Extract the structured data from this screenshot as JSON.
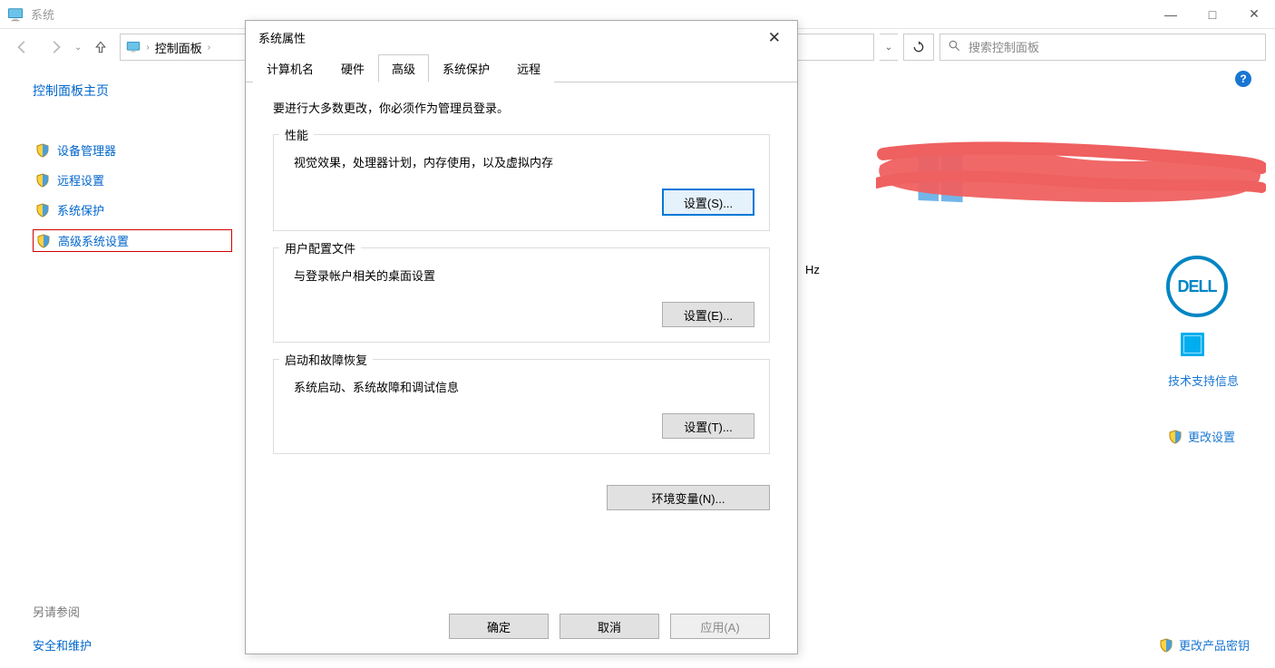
{
  "window": {
    "title": "系统",
    "controls": {
      "minimize": "—",
      "maximize": "□",
      "close": "✕"
    }
  },
  "breadcrumb": {
    "root": "控制面板",
    "dropdown": "⌄",
    "refresh": "⟳"
  },
  "search": {
    "placeholder": "搜索控制面板",
    "icon": "⌕"
  },
  "sidebar": {
    "home": "控制面板主页",
    "items": [
      "设备管理器",
      "远程设置",
      "系统保护",
      "高级系统设置"
    ],
    "see_also_label": "另请参阅",
    "see_also_link": "安全和维护"
  },
  "content": {
    "help": "?",
    "hz_suffix": "Hz",
    "dell": "DELL",
    "tech_support": "技术支持信息",
    "change_settings": "更改设置",
    "change_product_key": "更改产品密钥"
  },
  "dialog": {
    "title": "系统属性",
    "close": "✕",
    "tabs": [
      "计算机名",
      "硬件",
      "高级",
      "系统保护",
      "远程"
    ],
    "active_tab": "高级",
    "admin_note": "要进行大多数更改，你必须作为管理员登录。",
    "performance": {
      "title": "性能",
      "desc": "视觉效果，处理器计划，内存使用，以及虚拟内存",
      "button": "设置(S)..."
    },
    "profiles": {
      "title": "用户配置文件",
      "desc": "与登录帐户相关的桌面设置",
      "button": "设置(E)..."
    },
    "startup": {
      "title": "启动和故障恢复",
      "desc": "系统启动、系统故障和调试信息",
      "button": "设置(T)..."
    },
    "env_button": "环境变量(N)...",
    "footer": {
      "ok": "确定",
      "cancel": "取消",
      "apply": "应用(A)"
    }
  }
}
